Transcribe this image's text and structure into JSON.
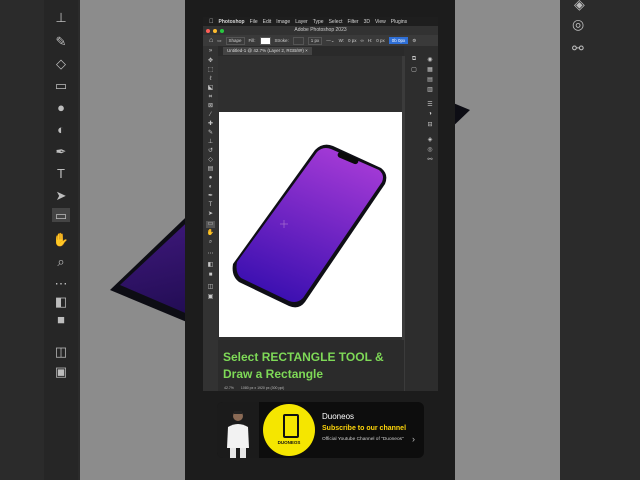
{
  "menu": {
    "apple": "",
    "app": "Photoshop",
    "items": [
      "File",
      "Edit",
      "Image",
      "Layer",
      "Type",
      "Select",
      "Filter",
      "3D",
      "View",
      "Plugins"
    ]
  },
  "window": {
    "title": "Adobe Photoshop 2023"
  },
  "options_bar": {
    "mode": "Shape",
    "fill_label": "Fill:",
    "stroke_label": "Stroke:",
    "stroke_width": "1 px",
    "w_label": "W:",
    "w_value": "0 px",
    "h_label": "H:",
    "h_value": "0 px",
    "highlight": "0b 0px"
  },
  "document": {
    "tab_label": "Untitled-1 @ 42.7% (Layer 2, RGB/8#)",
    "status_zoom": "42.7%",
    "status_info": "1080 px x 1920 px (300 ppi)"
  },
  "caption": {
    "line1": "Select RECTANGLE TOOL &",
    "line2": "Draw a Rectangle"
  },
  "ad": {
    "logo_text": "DUONEOS",
    "channel_name": "Duoneos",
    "subscribe": "Subscribe to our channel",
    "description": "Official Youtube Channel of \"Duoneos\"",
    "chevron": "›"
  },
  "colors": {
    "caption_text": "#7ed957",
    "subscribe_text": "#ffd60a",
    "logo_bg": "#f5e600",
    "phone_top": "#a43ad6",
    "phone_bottom": "#3a0fb0",
    "accent_blue": "#2f6fd6"
  },
  "icons": {
    "tools": [
      "move-icon",
      "marquee-icon",
      "lasso-icon",
      "object-select-icon",
      "crop-icon",
      "frame-icon",
      "eyedropper-icon",
      "healing-icon",
      "brush-icon",
      "stamp-icon",
      "history-brush-icon",
      "eraser-icon",
      "gradient-icon",
      "blur-icon",
      "dodge-icon",
      "pen-icon",
      "type-icon",
      "path-select-icon",
      "rectangle-icon",
      "hand-icon",
      "zoom-icon",
      "more-icon",
      "colors-icon",
      "quickmask-icon",
      "screenmode-icon"
    ]
  }
}
